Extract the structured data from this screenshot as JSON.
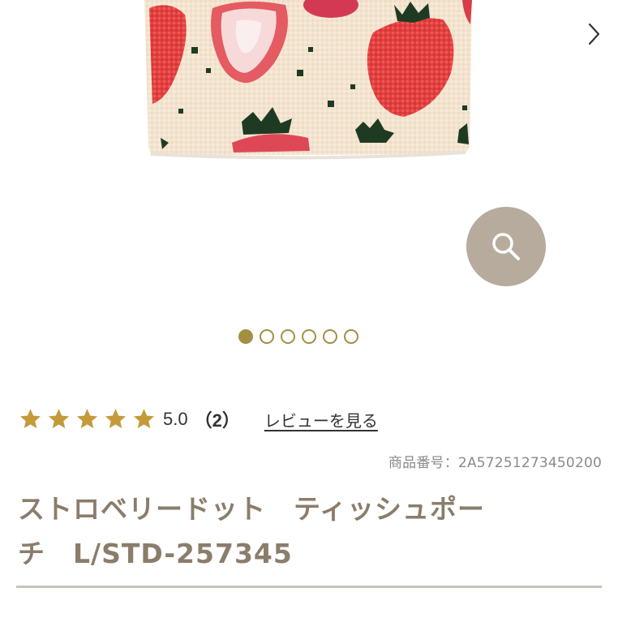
{
  "gallery": {
    "next_icon": "chevron-right-icon",
    "zoom_icon": "search-icon",
    "zoom_color": "#b6ab9c",
    "slide_count": 6,
    "active_slide": 1,
    "accent_color": "#a38f42"
  },
  "rating": {
    "stars": 5,
    "star_color": "#c49a3a",
    "value": "5.0",
    "count": "（2）",
    "review_link": "レビューを見る"
  },
  "product": {
    "number": "商品番号：2A57251273450200",
    "title_line1": "ストロベリードット　ティッシュポー",
    "title_line2": "チ　L/STD-257345",
    "title_color": "#8b7d6b"
  }
}
